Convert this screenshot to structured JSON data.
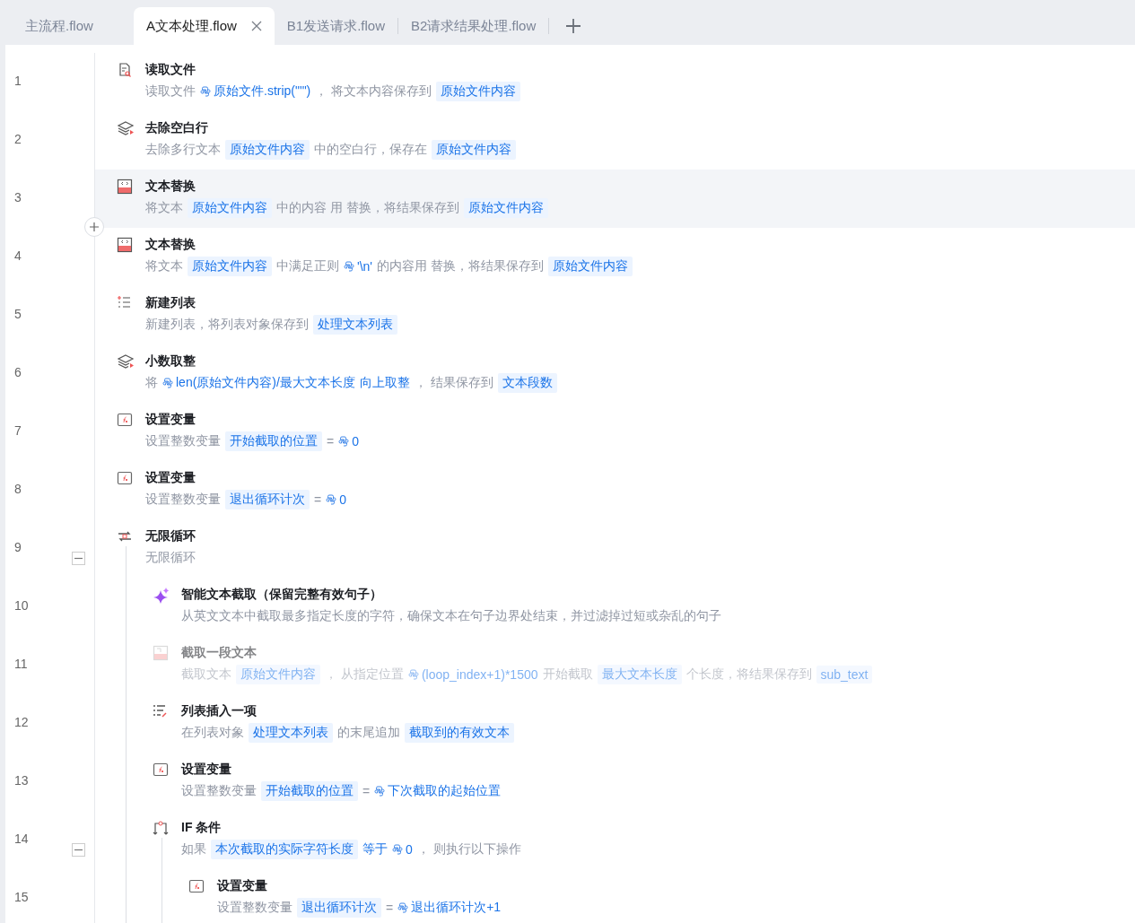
{
  "tabs": [
    {
      "label": "主流程.flow",
      "selected": false
    },
    {
      "label": "A文本处理.flow",
      "selected": true
    },
    {
      "label": "B1发送请求.flow",
      "selected": false
    },
    {
      "label": "B2请求结果处理.flow",
      "selected": false
    }
  ],
  "steps": [
    {
      "line": "1",
      "kind": "file-search",
      "title": "读取文件",
      "selected": false,
      "disabled": false,
      "parts": [
        {
          "kind": "text",
          "text": "读取文件"
        },
        {
          "kind": "expr",
          "text": "原始文件.strip(\"'\")"
        },
        {
          "kind": "text",
          "text": "，  将文本内容保存到"
        },
        {
          "kind": "var",
          "text": "原始文件内容"
        }
      ]
    },
    {
      "line": "2",
      "kind": "layers",
      "title": "去除空白行",
      "selected": false,
      "disabled": false,
      "parts": [
        {
          "kind": "text",
          "text": "去除多行文本"
        },
        {
          "kind": "var",
          "text": "原始文件内容"
        },
        {
          "kind": "text",
          "text": "中的空白行，保存在"
        },
        {
          "kind": "var",
          "text": "原始文件内容"
        }
      ]
    },
    {
      "line": "3",
      "kind": "replace",
      "title": "文本替换",
      "selected": true,
      "disabled": false,
      "parts": [
        {
          "kind": "text",
          "text": "将文本"
        },
        {
          "kind": "var",
          "text": "原始文件内容"
        },
        {
          "kind": "text",
          "text": "中的内容  用 替换，将结果保存到"
        },
        {
          "kind": "var",
          "text": "原始文件内容"
        }
      ]
    },
    {
      "line": "4",
      "kind": "replace",
      "title": "文本替换",
      "selected": false,
      "disabled": false,
      "parts": [
        {
          "kind": "text",
          "text": "将文本"
        },
        {
          "kind": "var",
          "text": "原始文件内容"
        },
        {
          "kind": "text",
          "text": "中满足正则"
        },
        {
          "kind": "expr",
          "text": "'\\n'"
        },
        {
          "kind": "text",
          "text": "的内容用 替换，将结果保存到"
        },
        {
          "kind": "var",
          "text": "原始文件内容"
        }
      ]
    },
    {
      "line": "5",
      "kind": "list-new",
      "title": "新建列表",
      "selected": false,
      "disabled": false,
      "parts": [
        {
          "kind": "text",
          "text": "新建列表，将列表对象保存到"
        },
        {
          "kind": "var",
          "text": "处理文本列表"
        }
      ]
    },
    {
      "line": "6",
      "kind": "layers",
      "title": "小数取整",
      "selected": false,
      "disabled": false,
      "parts": [
        {
          "kind": "text",
          "text": "将"
        },
        {
          "kind": "expr",
          "text": "len(原始文件内容)/最大文本长度"
        },
        {
          "kind": "value",
          "text": "向上取整"
        },
        {
          "kind": "text",
          "text": "，  结果保存到"
        },
        {
          "kind": "var",
          "text": "文本段数"
        }
      ]
    },
    {
      "line": "7",
      "kind": "set-var",
      "title": "设置变量",
      "selected": false,
      "disabled": false,
      "parts": [
        {
          "kind": "text",
          "text": "设置整数变量"
        },
        {
          "kind": "var",
          "text": "开始截取的位置"
        },
        {
          "kind": "text",
          "text": "="
        },
        {
          "kind": "expr",
          "text": "0"
        }
      ]
    },
    {
      "line": "8",
      "kind": "set-var",
      "title": "设置变量",
      "selected": false,
      "disabled": false,
      "parts": [
        {
          "kind": "text",
          "text": "设置整数变量"
        },
        {
          "kind": "var",
          "text": "退出循环计次"
        },
        {
          "kind": "text",
          "text": "="
        },
        {
          "kind": "expr",
          "text": "0"
        }
      ]
    },
    {
      "line": "9",
      "kind": "loop",
      "title": "无限循环",
      "selected": false,
      "disabled": false,
      "expanded": true,
      "parts": [
        {
          "kind": "text",
          "text": "无限循环"
        }
      ],
      "children": [
        {
          "line": "10",
          "kind": "sparkle",
          "title": "智能文本截取（保留完整有效句子）",
          "selected": false,
          "disabled": false,
          "parts": [
            {
              "kind": "text",
              "text": "从英文文本中截取最多指定长度的字符，确保文本在句子边界处结束，并过滤掉过短或杂乱的句子"
            }
          ]
        },
        {
          "line": "11",
          "kind": "cut",
          "title": "截取一段文本",
          "selected": false,
          "disabled": true,
          "parts": [
            {
              "kind": "text",
              "text": "截取文本"
            },
            {
              "kind": "var",
              "text": "原始文件内容"
            },
            {
              "kind": "text",
              "text": "，  从指定位置"
            },
            {
              "kind": "expr",
              "text": "(loop_index+1)*1500"
            },
            {
              "kind": "text",
              "text": "开始截取"
            },
            {
              "kind": "var",
              "text": "最大文本长度"
            },
            {
              "kind": "text",
              "text": "个长度，将结果保存到"
            },
            {
              "kind": "var",
              "text": "sub_text"
            }
          ]
        },
        {
          "line": "12",
          "kind": "list-insert",
          "title": "列表插入一项",
          "selected": false,
          "disabled": false,
          "parts": [
            {
              "kind": "text",
              "text": "在列表对象"
            },
            {
              "kind": "var",
              "text": "处理文本列表"
            },
            {
              "kind": "text",
              "text": "的末尾追加"
            },
            {
              "kind": "var",
              "text": "截取到的有效文本"
            }
          ]
        },
        {
          "line": "13",
          "kind": "set-var",
          "title": "设置变量",
          "selected": false,
          "disabled": false,
          "parts": [
            {
              "kind": "text",
              "text": "设置整数变量"
            },
            {
              "kind": "var",
              "text": "开始截取的位置"
            },
            {
              "kind": "text",
              "text": "="
            },
            {
              "kind": "expr",
              "text": "下次截取的起始位置"
            }
          ]
        },
        {
          "line": "14",
          "kind": "if",
          "title": "IF 条件",
          "selected": false,
          "disabled": false,
          "expanded": true,
          "parts": [
            {
              "kind": "text",
              "text": "如果"
            },
            {
              "kind": "var",
              "text": "本次截取的实际字符长度"
            },
            {
              "kind": "value",
              "text": "等于"
            },
            {
              "kind": "expr",
              "text": "0"
            },
            {
              "kind": "text",
              "text": "，  则执行以下操作"
            }
          ],
          "children": [
            {
              "line": "15",
              "kind": "set-var",
              "title": "设置变量",
              "selected": false,
              "disabled": false,
              "parts": [
                {
                  "kind": "text",
                  "text": "设置整数变量"
                },
                {
                  "kind": "var",
                  "text": "退出循环计次"
                },
                {
                  "kind": "text",
                  "text": "="
                },
                {
                  "kind": "expr",
                  "text": "退出循环计次+1"
                }
              ]
            }
          ]
        }
      ]
    }
  ]
}
